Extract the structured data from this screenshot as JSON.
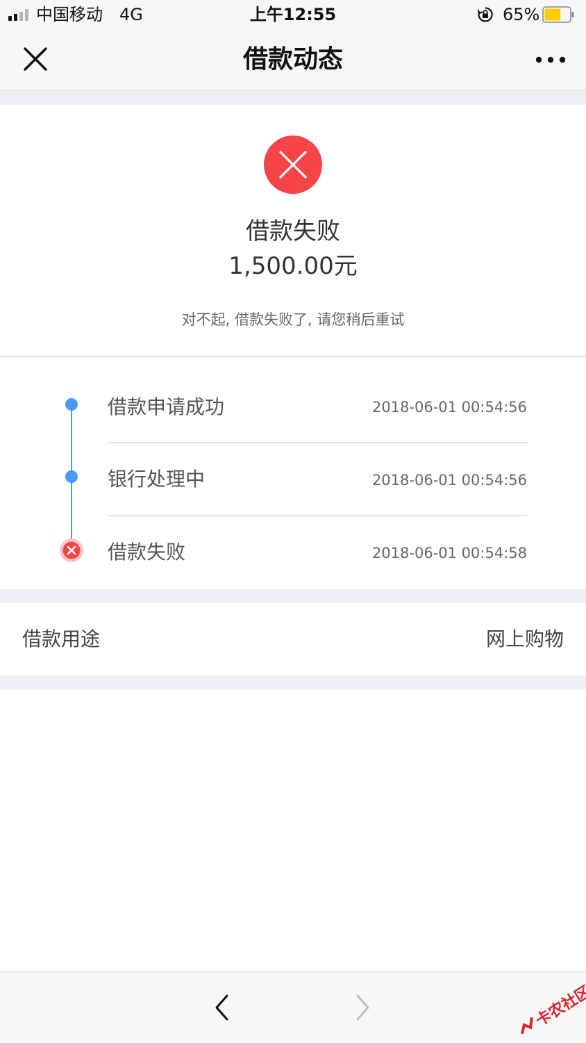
{
  "status_bar": {
    "carrier": "中国移动",
    "network": "4G",
    "time": "上午12:55",
    "battery_percent": "65%",
    "battery_level": 0.65,
    "battery_color": "#ffcc00"
  },
  "nav": {
    "title": "借款动态",
    "close_icon": "close-icon",
    "more_icon": "more-icon"
  },
  "result": {
    "status_icon": "fail-icon",
    "status_color": "#f64449",
    "title": "借款失败",
    "amount": "1,500.00元",
    "message": "对不起, 借款失败了, 请您稍后重试"
  },
  "timeline": {
    "accent_color": "#4a98f7",
    "steps": [
      {
        "label": "借款申请成功",
        "time": "2018-06-01 00:54:56",
        "state": "done"
      },
      {
        "label": "银行处理中",
        "time": "2018-06-01 00:54:56",
        "state": "done"
      },
      {
        "label": "借款失败",
        "time": "2018-06-01 00:54:58",
        "state": "failed"
      }
    ]
  },
  "purpose": {
    "label": "借款用途",
    "value": "网上购物"
  },
  "toolbar": {
    "back_icon": "chevron-left-icon",
    "forward_icon": "chevron-right-icon"
  },
  "watermark": {
    "text": "卡农社区"
  }
}
